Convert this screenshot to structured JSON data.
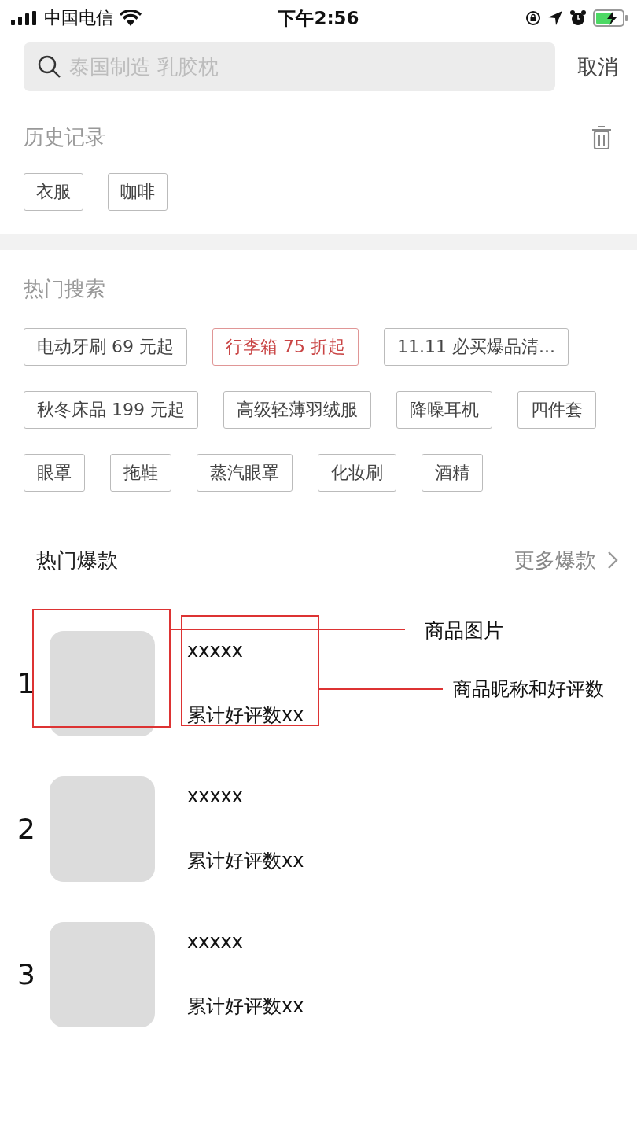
{
  "status_bar": {
    "carrier": "中国电信",
    "time": "下午2:56"
  },
  "search": {
    "placeholder": "泰国制造 乳胶枕",
    "cancel": "取消"
  },
  "history": {
    "title": "历史记录",
    "tags": [
      "衣服",
      "咖啡"
    ]
  },
  "hot_search": {
    "title": "热门搜索",
    "tags": [
      {
        "label": "电动牙刷 69 元起",
        "highlighted": false
      },
      {
        "label": "行李箱 75 折起",
        "highlighted": true
      },
      {
        "label": "11.11 必买爆品清...",
        "highlighted": false
      },
      {
        "label": "秋冬床品 199 元起",
        "highlighted": false
      },
      {
        "label": "高级轻薄羽绒服",
        "highlighted": false
      },
      {
        "label": "降噪耳机",
        "highlighted": false
      },
      {
        "label": "四件套",
        "highlighted": false
      },
      {
        "label": "眼罩",
        "highlighted": false
      },
      {
        "label": "拖鞋",
        "highlighted": false
      },
      {
        "label": "蒸汽眼罩",
        "highlighted": false
      },
      {
        "label": "化妆刷",
        "highlighted": false
      },
      {
        "label": "酒精",
        "highlighted": false
      }
    ]
  },
  "hot_items": {
    "title": "热门爆款",
    "more": "更多爆款",
    "items": [
      {
        "rank": "1",
        "name": "xxxxx",
        "reviews": "累计好评数xx"
      },
      {
        "rank": "2",
        "name": "xxxxx",
        "reviews": "累计好评数xx"
      },
      {
        "rank": "3",
        "name": "xxxxx",
        "reviews": "累计好评数xx"
      }
    ]
  },
  "annotations": [
    {
      "label": "商品图片"
    },
    {
      "label": "商品昵称和好评数"
    }
  ]
}
